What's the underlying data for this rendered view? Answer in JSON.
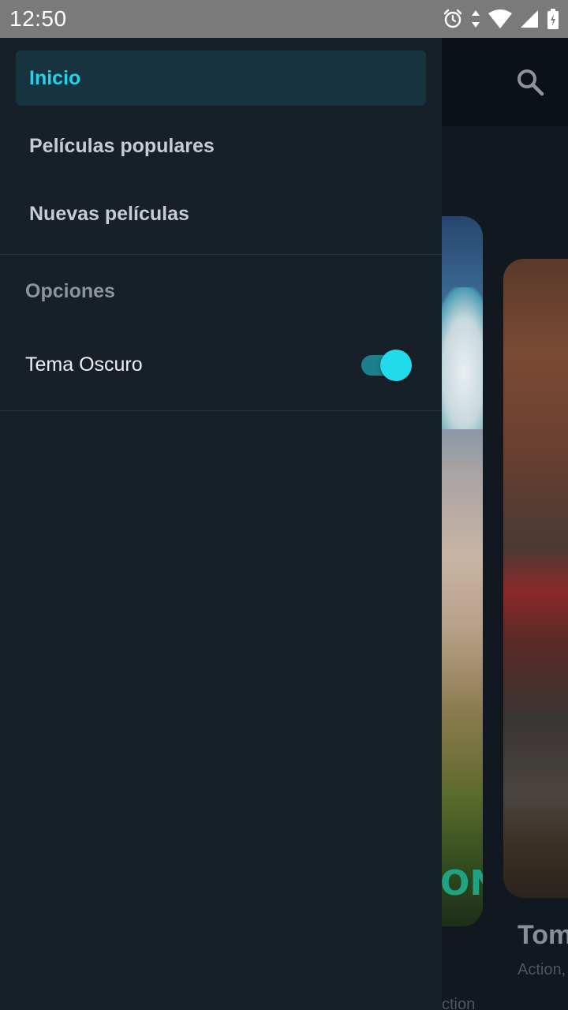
{
  "status_bar": {
    "time": "12:50",
    "icons": [
      "alarm-icon",
      "data-arrows-icon",
      "wifi-icon",
      "cell-signal-icon",
      "battery-icon"
    ]
  },
  "background_app": {
    "toolbar_icons": [
      "search-icon"
    ],
    "peek_title": "Tom",
    "peek_genre": "Action,",
    "peek_genre_2": "ction"
  },
  "drawer": {
    "nav_items": [
      {
        "label": "Inicio",
        "active": true
      },
      {
        "label": "Películas populares",
        "active": false
      },
      {
        "label": "Nuevas películas",
        "active": false
      }
    ],
    "options_header": "Opciones",
    "settings": [
      {
        "label": "Tema Oscuro",
        "enabled": true
      }
    ]
  },
  "colors": {
    "accent": "#21d4ea",
    "drawer_bg": "#171f29",
    "active_item_bg": "#173340",
    "status_bar_bg": "#7a7a7a"
  }
}
